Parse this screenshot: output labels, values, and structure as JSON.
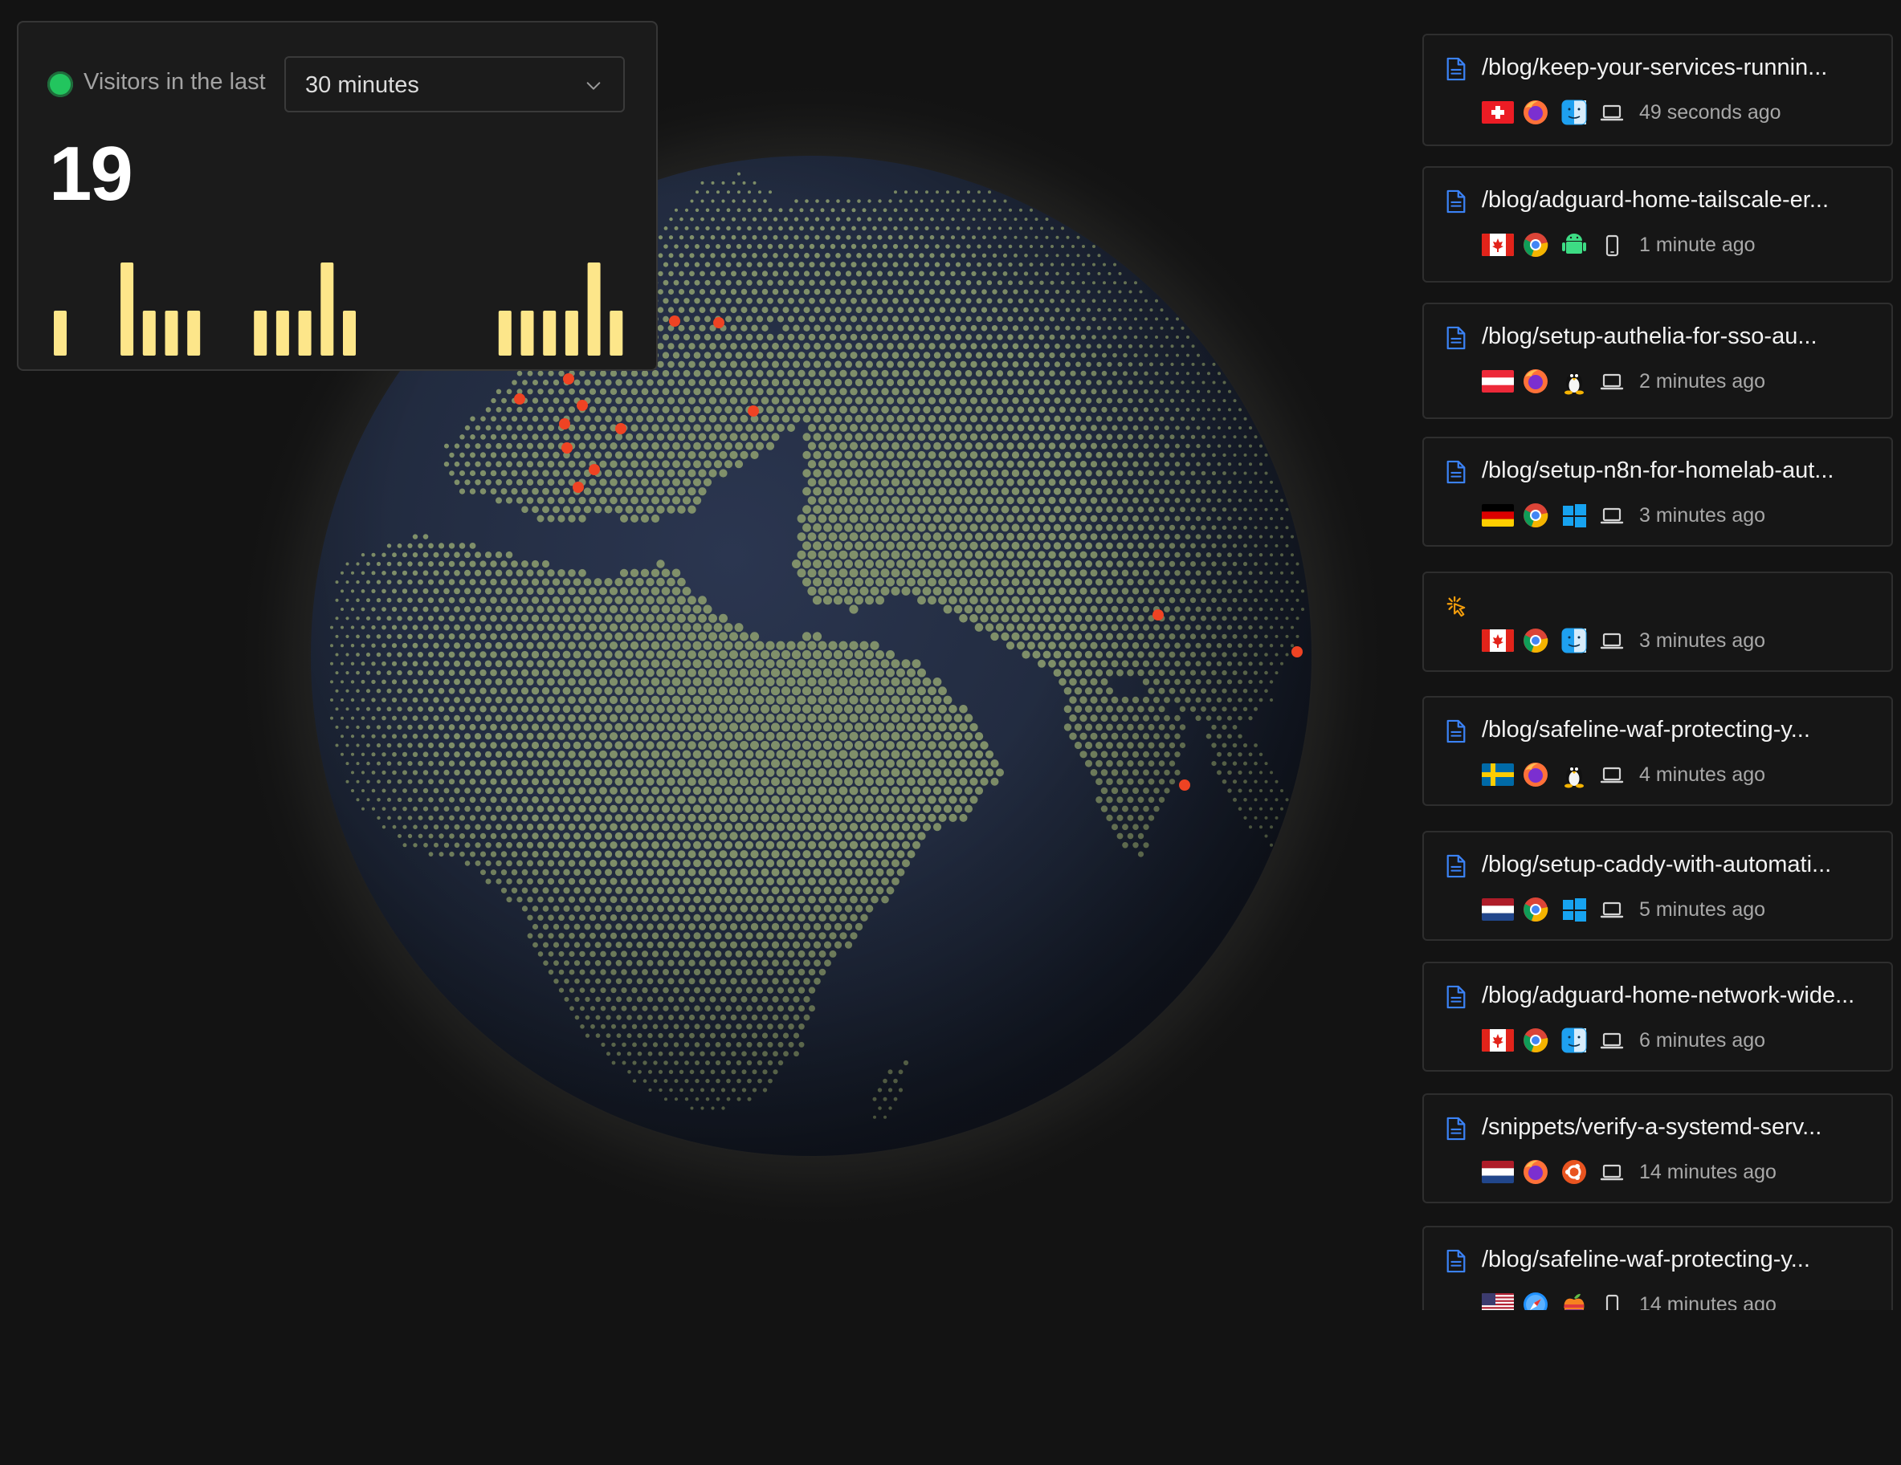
{
  "visitors": {
    "label": "Visitors in the last",
    "range_selected": "30 minutes",
    "count": "19",
    "bars": [
      1,
      0,
      0,
      2,
      1,
      1,
      1,
      0,
      0,
      1,
      1,
      1,
      2,
      1,
      0,
      0,
      0,
      0,
      0,
      0,
      1,
      1,
      1,
      1,
      2,
      1
    ]
  },
  "globe": {
    "visitor_markers": 17,
    "ocean_color": "#222c42",
    "land_color": "#8a9a6e",
    "marker_color": "#ef4323"
  },
  "feed": [
    {
      "title": "/blog/keep-your-services-runnin...",
      "flag": "ch",
      "browser": "firefox",
      "os": "macos",
      "device": "laptop",
      "time": "49 seconds ago"
    },
    {
      "title": "/blog/adguard-home-tailscale-er...",
      "flag": "ca",
      "browser": "chrome",
      "os": "android",
      "device": "phone",
      "time": "1 minute ago"
    },
    {
      "title": "/blog/setup-authelia-for-sso-au...",
      "flag": "at",
      "browser": "firefox",
      "os": "linux",
      "device": "laptop",
      "time": "2 minutes ago"
    },
    {
      "title": "/blog/setup-n8n-for-homelab-aut...",
      "flag": "de",
      "browser": "chrome",
      "os": "windows",
      "device": "laptop",
      "time": "3 minutes ago"
    },
    {
      "title": "",
      "icon": "click-event-icon",
      "flag": "ca",
      "browser": "chrome",
      "os": "macos",
      "device": "laptop",
      "time": "3 minutes ago"
    },
    {
      "title": "/blog/safeline-waf-protecting-y...",
      "flag": "se",
      "browser": "firefox",
      "os": "linux",
      "device": "laptop",
      "time": "4 minutes ago"
    },
    {
      "title": "/blog/setup-caddy-with-automati...",
      "flag": "nl",
      "browser": "chrome",
      "os": "windows",
      "device": "laptop",
      "time": "5 minutes ago"
    },
    {
      "title": "/blog/adguard-home-network-wide...",
      "flag": "ca",
      "browser": "chrome",
      "os": "macos",
      "device": "laptop",
      "time": "6 minutes ago"
    },
    {
      "title": "/snippets/verify-a-systemd-serv...",
      "flag": "nl",
      "browser": "firefox",
      "os": "ubuntu",
      "device": "laptop",
      "time": "14 minutes ago"
    },
    {
      "title": "/blog/safeline-waf-protecting-y...",
      "flag": "us",
      "browser": "safari",
      "os": "ios",
      "device": "phone",
      "time": "14 minutes ago"
    }
  ]
}
